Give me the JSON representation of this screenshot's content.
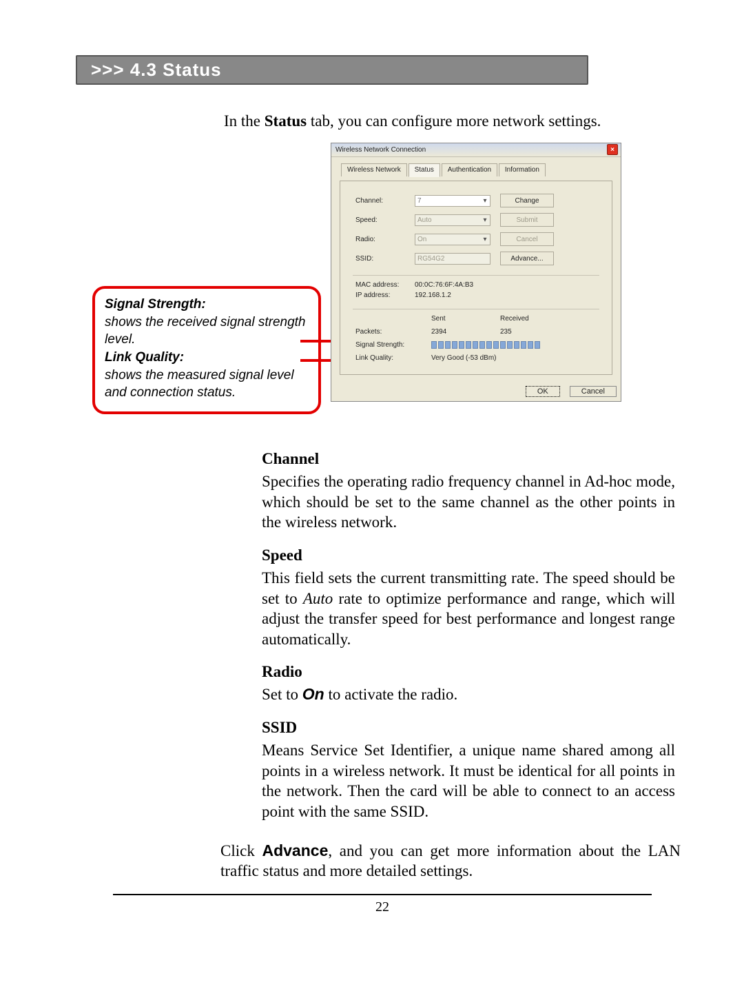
{
  "section_header": ">>> 4.3  Status",
  "intro_prefix": "In the ",
  "intro_bold": "Status",
  "intro_suffix": " tab, you can configure more network settings.",
  "callout": {
    "h1": "Signal Strength:",
    "t1": "shows the received signal strength level.",
    "h2": "Link Quality:",
    "t2": "shows the measured signal level and connection status."
  },
  "dialog": {
    "title": "Wireless Network Connection",
    "tabs": [
      "Wireless Network",
      "Status",
      "Authentication",
      "Information"
    ],
    "active_tab": "Status",
    "fields": {
      "channel_label": "Channel:",
      "channel_value": "7",
      "speed_label": "Speed:",
      "speed_value": "Auto",
      "radio_label": "Radio:",
      "radio_value": "On",
      "ssid_label": "SSID:",
      "ssid_value": "RG54G2"
    },
    "buttons": {
      "change": "Change",
      "submit": "Submit",
      "cancel_small": "Cancel",
      "advance": "Advance..."
    },
    "addresses": {
      "mac_label": "MAC address:",
      "mac_value": "00:0C:76:6F:4A:B3",
      "ip_label": "IP address:",
      "ip_value": "192.168.1.2"
    },
    "stats": {
      "sent_h": "Sent",
      "recv_h": "Received",
      "packets_label": "Packets:",
      "packets_sent": "2394",
      "packets_recv": "235",
      "sig_label": "Signal Strength:",
      "link_label": "Link Quality:",
      "link_value": "Very Good (-53 dBm)"
    },
    "ok": "OK",
    "cancel": "Cancel"
  },
  "body": {
    "channel_h": "Channel",
    "channel_p": "Specifies the operating radio frequency channel in Ad-hoc mode, which should be set to the same channel as the other points in the wireless network.",
    "speed_h": "Speed",
    "speed_p1": "This field sets the current transmitting rate.  The speed should be set to ",
    "speed_auto": "Auto",
    "speed_p2": " rate to optimize performance and range, which will adjust the transfer speed for best perfor­mance and longest range automatically.",
    "radio_h": "Radio",
    "radio_p1": "Set to ",
    "radio_on": "On",
    "radio_p2": " to activate the radio.",
    "ssid_h": "SSID",
    "ssid_p": "Means Service Set Identifier, a unique name shared among all points in a wireless network. It must be identical for all points in the network.  Then the card  will be able to connect to an access point with the same SSID."
  },
  "final_p1": "Click ",
  "final_adv": "Advance",
  "final_p2": ", and you can get more information about the LAN traffic status and more detailed settings.",
  "page_number": "22"
}
